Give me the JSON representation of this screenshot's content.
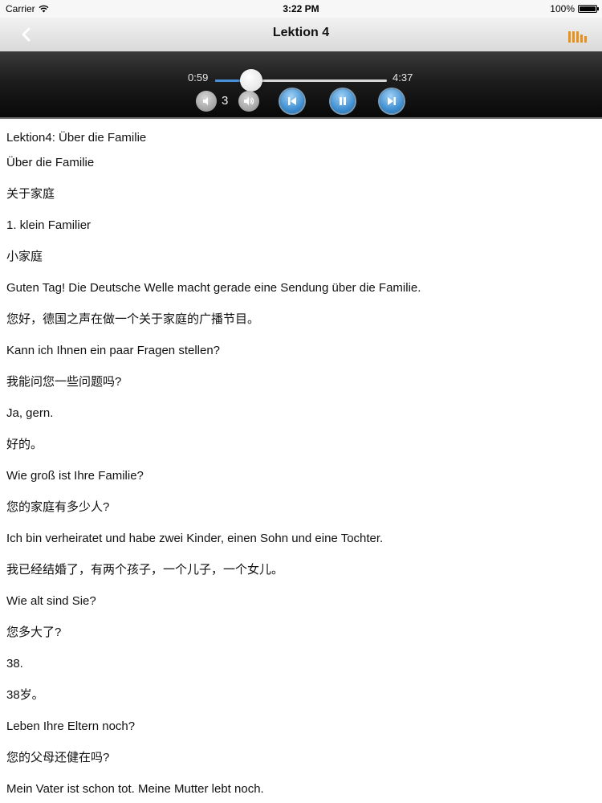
{
  "status_bar": {
    "carrier": "Carrier",
    "time": "3:22 PM",
    "battery": "100%",
    "icons": [
      "wifi-icon",
      "battery-icon"
    ]
  },
  "nav": {
    "title": "Lektion 4",
    "back_icon": "chevron-left-icon",
    "library_icon": "library-bars-icon",
    "accent_color": "#e8901e"
  },
  "player": {
    "elapsed": "0:59",
    "total": "4:37",
    "progress_fraction": 0.21,
    "volume_level": "3",
    "controls": [
      "volume-down-icon",
      "volume-up-icon",
      "skip-previous-icon",
      "pause-icon",
      "skip-next-icon"
    ],
    "accent_color": "#4a90d9"
  },
  "content": {
    "heading": "Lektion4: Über die Familie",
    "lines": [
      "Über die Familie",
      "关于家庭",
      "1. klein Familier",
      "小家庭",
      "Guten Tag! Die Deutsche Welle macht gerade eine Sendung über die Familie.",
      "您好，德国之声在做一个关于家庭的广播节目。",
      "Kann ich Ihnen ein paar Fragen stellen?",
      "我能问您一些问题吗?",
      "Ja, gern.",
      "好的。",
      "Wie groß ist Ihre Familie?",
      "您的家庭有多少人?",
      "Ich bin verheiratet und habe zwei Kinder, einen Sohn und eine Tochter.",
      "我已经结婚了，有两个孩子，一个儿子，一个女儿。",
      "Wie alt sind Sie?",
      "您多大了?",
      "38.",
      "38岁。",
      "Leben Ihre Eltern noch?",
      "您的父母还健在吗?",
      "Mein Vater ist schon tot. Meine Mutter lebt noch."
    ]
  }
}
